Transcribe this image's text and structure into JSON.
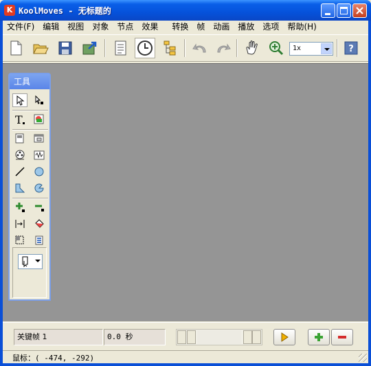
{
  "window": {
    "title": "KoolMoves - 无标题的",
    "app_icon_letter": "K"
  },
  "menu": {
    "items": [
      {
        "label": "文件(F)"
      },
      {
        "label": "编辑"
      },
      {
        "label": "视图"
      },
      {
        "label": "对象"
      },
      {
        "label": "节点"
      },
      {
        "label": "效果"
      },
      {
        "label": "转换"
      },
      {
        "label": "帧"
      },
      {
        "label": "动画"
      },
      {
        "label": "播放"
      },
      {
        "label": "选项"
      },
      {
        "label": "帮助(H)"
      }
    ]
  },
  "toolbar": {
    "zoom_value": "1x",
    "buttons": [
      "new-file-icon",
      "open-folder-icon",
      "save-disk-icon",
      "export-icon",
      "properties-icon",
      "clock-icon",
      "scene-tree-icon",
      "undo-icon",
      "redo-icon",
      "hand-icon",
      "zoom-in-icon",
      "help-icon"
    ]
  },
  "tools_panel": {
    "title": "工具"
  },
  "timeline": {
    "keyframe_label": "关键帧 1",
    "time_value": "0.0 秒"
  },
  "status": {
    "label": "鼠标：",
    "coords": "( -474, -292)"
  },
  "colors": {
    "titlebar": "#0A5FE8",
    "stage": "#959595",
    "close_button": "#C5401F",
    "add_frame": "#3BA334",
    "remove_frame": "#D42C2C",
    "play": "#E9A100"
  }
}
